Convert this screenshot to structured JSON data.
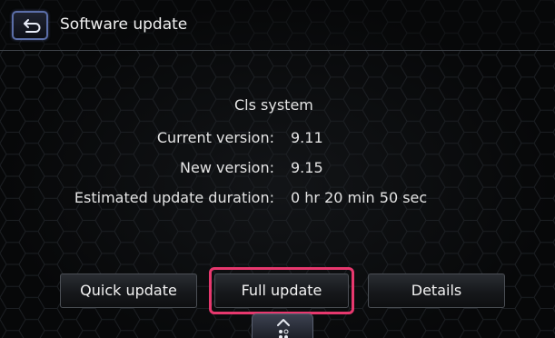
{
  "header": {
    "title": "Software update",
    "back_icon": "back-arrow-icon"
  },
  "info": {
    "system_name": "Cls system",
    "rows": [
      {
        "label": "Current version:",
        "value": "9.11"
      },
      {
        "label": "New version:",
        "value": "9.15"
      },
      {
        "label": "Estimated update duration:",
        "value": "0 hr 20 min 50 sec"
      }
    ]
  },
  "buttons": {
    "quick_update": "Quick update",
    "full_update": "Full update",
    "details": "Details",
    "focused": "full_update"
  },
  "colors": {
    "background": "#070809",
    "text": "#e4e4e4",
    "focus_ring": "#e7386e",
    "back_button_border": "#5b6ea8"
  },
  "handle": {
    "icon": "chevron-up-icon",
    "page_dots_icon": "page-dots-icon"
  }
}
